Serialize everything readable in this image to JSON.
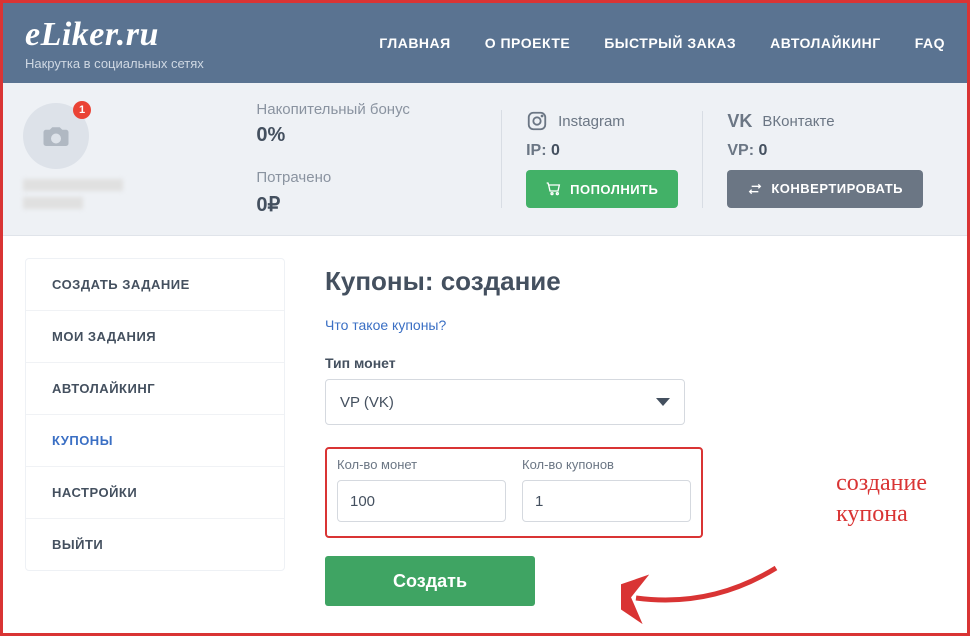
{
  "header": {
    "logo": "eLiker.ru",
    "tagline": "Накрутка в социальных сетях",
    "nav": [
      "ГЛАВНАЯ",
      "О ПРОЕКТЕ",
      "БЫСТРЫЙ ЗАКАЗ",
      "АВТОЛАЙКИНГ",
      "FAQ"
    ]
  },
  "stats": {
    "avatar_badge": "1",
    "bonus_label": "Накопительный бонус",
    "bonus_value": "0%",
    "spent_label": "Потрачено",
    "spent_value": "0₽",
    "instagram": {
      "name": "Instagram",
      "label": "IP:",
      "value": "0"
    },
    "vk": {
      "name": "ВКонтакте",
      "label": "VP:",
      "value": "0"
    },
    "replenish_btn": "ПОПОЛНИТЬ",
    "convert_btn": "КОНВЕРТИРОВАТЬ"
  },
  "sidebar": {
    "items": [
      "СОЗДАТЬ ЗАДАНИЕ",
      "МОИ ЗАДАНИЯ",
      "АВТОЛАЙКИНГ",
      "КУПОНЫ",
      "НАСТРОЙКИ",
      "ВЫЙТИ"
    ],
    "active_index": 3
  },
  "content": {
    "title": "Купоны: создание",
    "help_link": "Что такое купоны?",
    "coin_type_label": "Тип монет",
    "coin_type_value": "VP (VK)",
    "coins_label": "Кол-во монет",
    "coins_value": "100",
    "coupons_label": "Кол-во купонов",
    "coupons_value": "1",
    "create_btn": "Создать"
  },
  "annotation": {
    "text_line1": "создание",
    "text_line2": "купона"
  }
}
